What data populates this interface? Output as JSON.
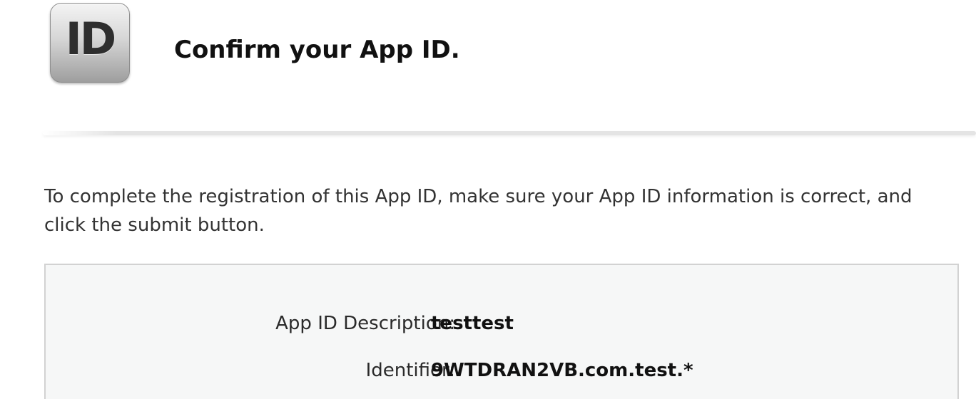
{
  "header": {
    "icon_text": "ID",
    "title": "Confirm your App ID."
  },
  "intro": {
    "text": "To complete the registration of this App ID, make sure your App ID information is correct, and click the submit button."
  },
  "details": {
    "rows": [
      {
        "label": "App ID Description:",
        "value": "testtest"
      },
      {
        "label": "Identifier:",
        "value": "9WTDRAN2VB.com.test.*"
      }
    ]
  }
}
